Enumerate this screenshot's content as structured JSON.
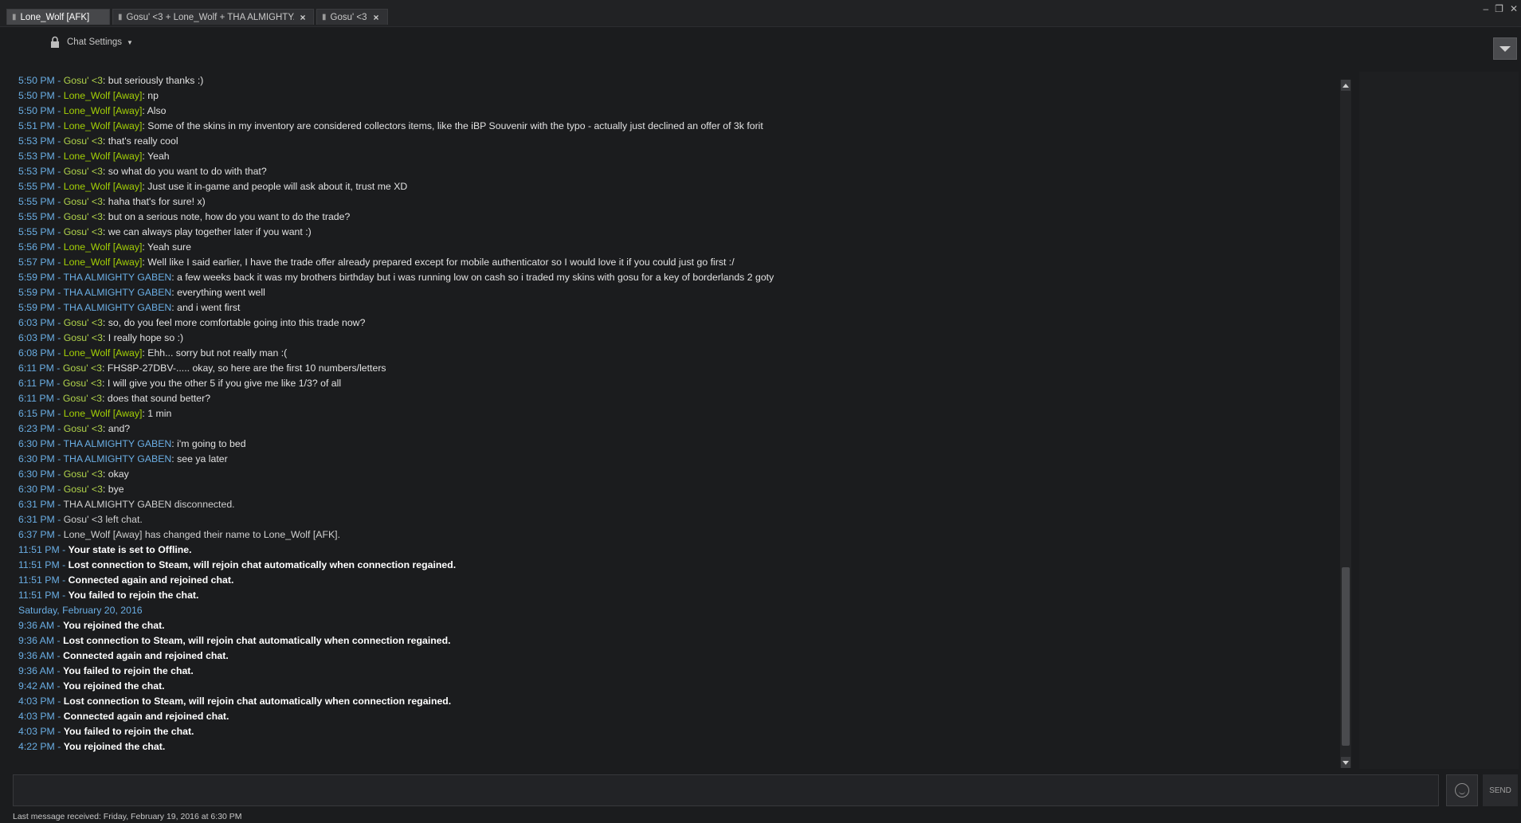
{
  "window": {
    "tabs": [
      {
        "label": "Lone_Wolf [AFK]",
        "active": true
      },
      {
        "label": "Gosu' <3 + Lone_Wolf + THA ALMIGHTY...",
        "active": false
      },
      {
        "label": "Gosu' <3",
        "active": false
      }
    ],
    "controls": {
      "minimize": "–",
      "restore": "❐",
      "close": "✕"
    }
  },
  "settings": {
    "label": "Chat Settings"
  },
  "colors": {
    "time": "#6aaee4",
    "self": "#a3cf06",
    "friend": "#b0d24b",
    "gaben": "#6aaee4"
  },
  "messages": [
    {
      "time": "5:50 PM",
      "nick": "Gosu' <3",
      "kind": "friend",
      "text": "but seriously thanks :)"
    },
    {
      "time": "5:50 PM",
      "nick": "Lone_Wolf [Away]",
      "kind": "self",
      "text": "np"
    },
    {
      "time": "5:50 PM",
      "nick": "Lone_Wolf [Away]",
      "kind": "self",
      "text": "Also"
    },
    {
      "time": "5:51 PM",
      "nick": "Lone_Wolf [Away]",
      "kind": "self",
      "text": "Some of the skins in my inventory are considered collectors items, like the iBP Souvenir with the typo - actually just declined an offer of 3k forit"
    },
    {
      "time": "5:53 PM",
      "nick": "Gosu' <3",
      "kind": "friend",
      "text": "that's really cool"
    },
    {
      "time": "5:53 PM",
      "nick": "Lone_Wolf [Away]",
      "kind": "self",
      "text": "Yeah"
    },
    {
      "time": "5:53 PM",
      "nick": "Gosu' <3",
      "kind": "friend",
      "text": "so what do you want to do with that?"
    },
    {
      "time": "5:55 PM",
      "nick": "Lone_Wolf [Away]",
      "kind": "self",
      "text": "Just use it in-game and people will ask about it, trust me XD"
    },
    {
      "time": "5:55 PM",
      "nick": "Gosu' <3",
      "kind": "friend",
      "text": "haha that's for sure! x)"
    },
    {
      "time": "5:55 PM",
      "nick": "Gosu' <3",
      "kind": "friend",
      "text": "but on a serious note, how do you want to do the trade?"
    },
    {
      "time": "5:55 PM",
      "nick": "Gosu' <3",
      "kind": "friend",
      "text": "we can always play together later if you want  :)"
    },
    {
      "time": "5:56 PM",
      "nick": "Lone_Wolf [Away]",
      "kind": "self",
      "text": "Yeah sure"
    },
    {
      "time": "5:57 PM",
      "nick": "Lone_Wolf [Away]",
      "kind": "self",
      "text": "Well like I said earlier, I have the trade offer already prepared except for mobile authenticator so I would love it if you could just go first :/"
    },
    {
      "time": "5:59 PM",
      "nick": "THA ALMIGHTY GABEN",
      "kind": "gaben",
      "text": "a few weeks back it was my brothers birthday but i was running low on cash so i traded my skins with gosu for a key of borderlands 2 goty"
    },
    {
      "time": "5:59 PM",
      "nick": "THA ALMIGHTY GABEN",
      "kind": "gaben",
      "text": "everything went well"
    },
    {
      "time": "5:59 PM",
      "nick": "THA ALMIGHTY GABEN",
      "kind": "gaben",
      "text": "and i went first"
    },
    {
      "time": "6:03 PM",
      "nick": "Gosu' <3",
      "kind": "friend",
      "text": "so, do you feel more comfortable going into this trade now?"
    },
    {
      "time": "6:03 PM",
      "nick": "Gosu' <3",
      "kind": "friend",
      "text": "I really hope so :)"
    },
    {
      "time": "6:08 PM",
      "nick": "Lone_Wolf [Away]",
      "kind": "self",
      "text": "Ehh... sorry but not really man :("
    },
    {
      "time": "6:11 PM",
      "nick": "Gosu' <3",
      "kind": "friend",
      "text": "FHS8P-27DBV-..... okay, so here are the first 10 numbers/letters"
    },
    {
      "time": "6:11 PM",
      "nick": "Gosu' <3",
      "kind": "friend",
      "text": "I will give you the other 5 if you give me like 1/3? of all"
    },
    {
      "time": "6:11 PM",
      "nick": "Gosu' <3",
      "kind": "friend",
      "text": "does that sound better?"
    },
    {
      "time": "6:15 PM",
      "nick": "Lone_Wolf [Away]",
      "kind": "self",
      "text": "1 min"
    },
    {
      "time": "6:23 PM",
      "nick": "Gosu' <3",
      "kind": "friend",
      "text": "and?"
    },
    {
      "time": "6:30 PM",
      "nick": "THA ALMIGHTY GABEN",
      "kind": "gaben",
      "text": "i'm going to bed"
    },
    {
      "time": "6:30 PM",
      "nick": "THA ALMIGHTY GABEN",
      "kind": "gaben",
      "text": "see ya later"
    },
    {
      "time": "6:30 PM",
      "nick": "Gosu' <3",
      "kind": "friend",
      "text": "okay"
    },
    {
      "time": "6:30 PM",
      "nick": "Gosu' <3",
      "kind": "friend",
      "text": "bye"
    }
  ],
  "events": [
    {
      "time": "6:31 PM",
      "text": "THA ALMIGHTY GABEN disconnected."
    },
    {
      "time": "6:31 PM",
      "text": "Gosu' <3 left chat."
    },
    {
      "time": "6:37 PM",
      "text": "Lone_Wolf [Away] has changed their name to Lone_Wolf [AFK]."
    }
  ],
  "status_events": [
    {
      "time": "11:51 PM",
      "text": "Your state is set to Offline."
    },
    {
      "time": "11:51 PM",
      "text": "Lost connection to Steam, will rejoin chat automatically when connection regained."
    },
    {
      "time": "11:51 PM",
      "text": "Connected again and rejoined chat."
    },
    {
      "time": "11:51 PM",
      "text": "You failed to rejoin the chat."
    }
  ],
  "date_divider": "Saturday, February 20, 2016",
  "status_events_2": [
    {
      "time": "9:36 AM",
      "text": "You rejoined the chat."
    },
    {
      "time": "9:36 AM",
      "text": "Lost connection to Steam, will rejoin chat automatically when connection regained."
    },
    {
      "time": "9:36 AM",
      "text": "Connected again and rejoined chat."
    },
    {
      "time": "9:36 AM",
      "text": "You failed to rejoin the chat."
    },
    {
      "time": "9:42 AM",
      "text": "You rejoined the chat."
    },
    {
      "time": "4:03 PM",
      "text": "Lost connection to Steam, will rejoin chat automatically when connection regained."
    },
    {
      "time": "4:03 PM",
      "text": "Connected again and rejoined chat."
    },
    {
      "time": "4:03 PM",
      "text": "You failed to rejoin the chat."
    },
    {
      "time": "4:22 PM",
      "text": "You rejoined the chat."
    }
  ],
  "input": {
    "value": "",
    "placeholder": ""
  },
  "send_label": "SEND",
  "status_line": "Last message received: Friday, February 19, 2016 at 6:30 PM"
}
